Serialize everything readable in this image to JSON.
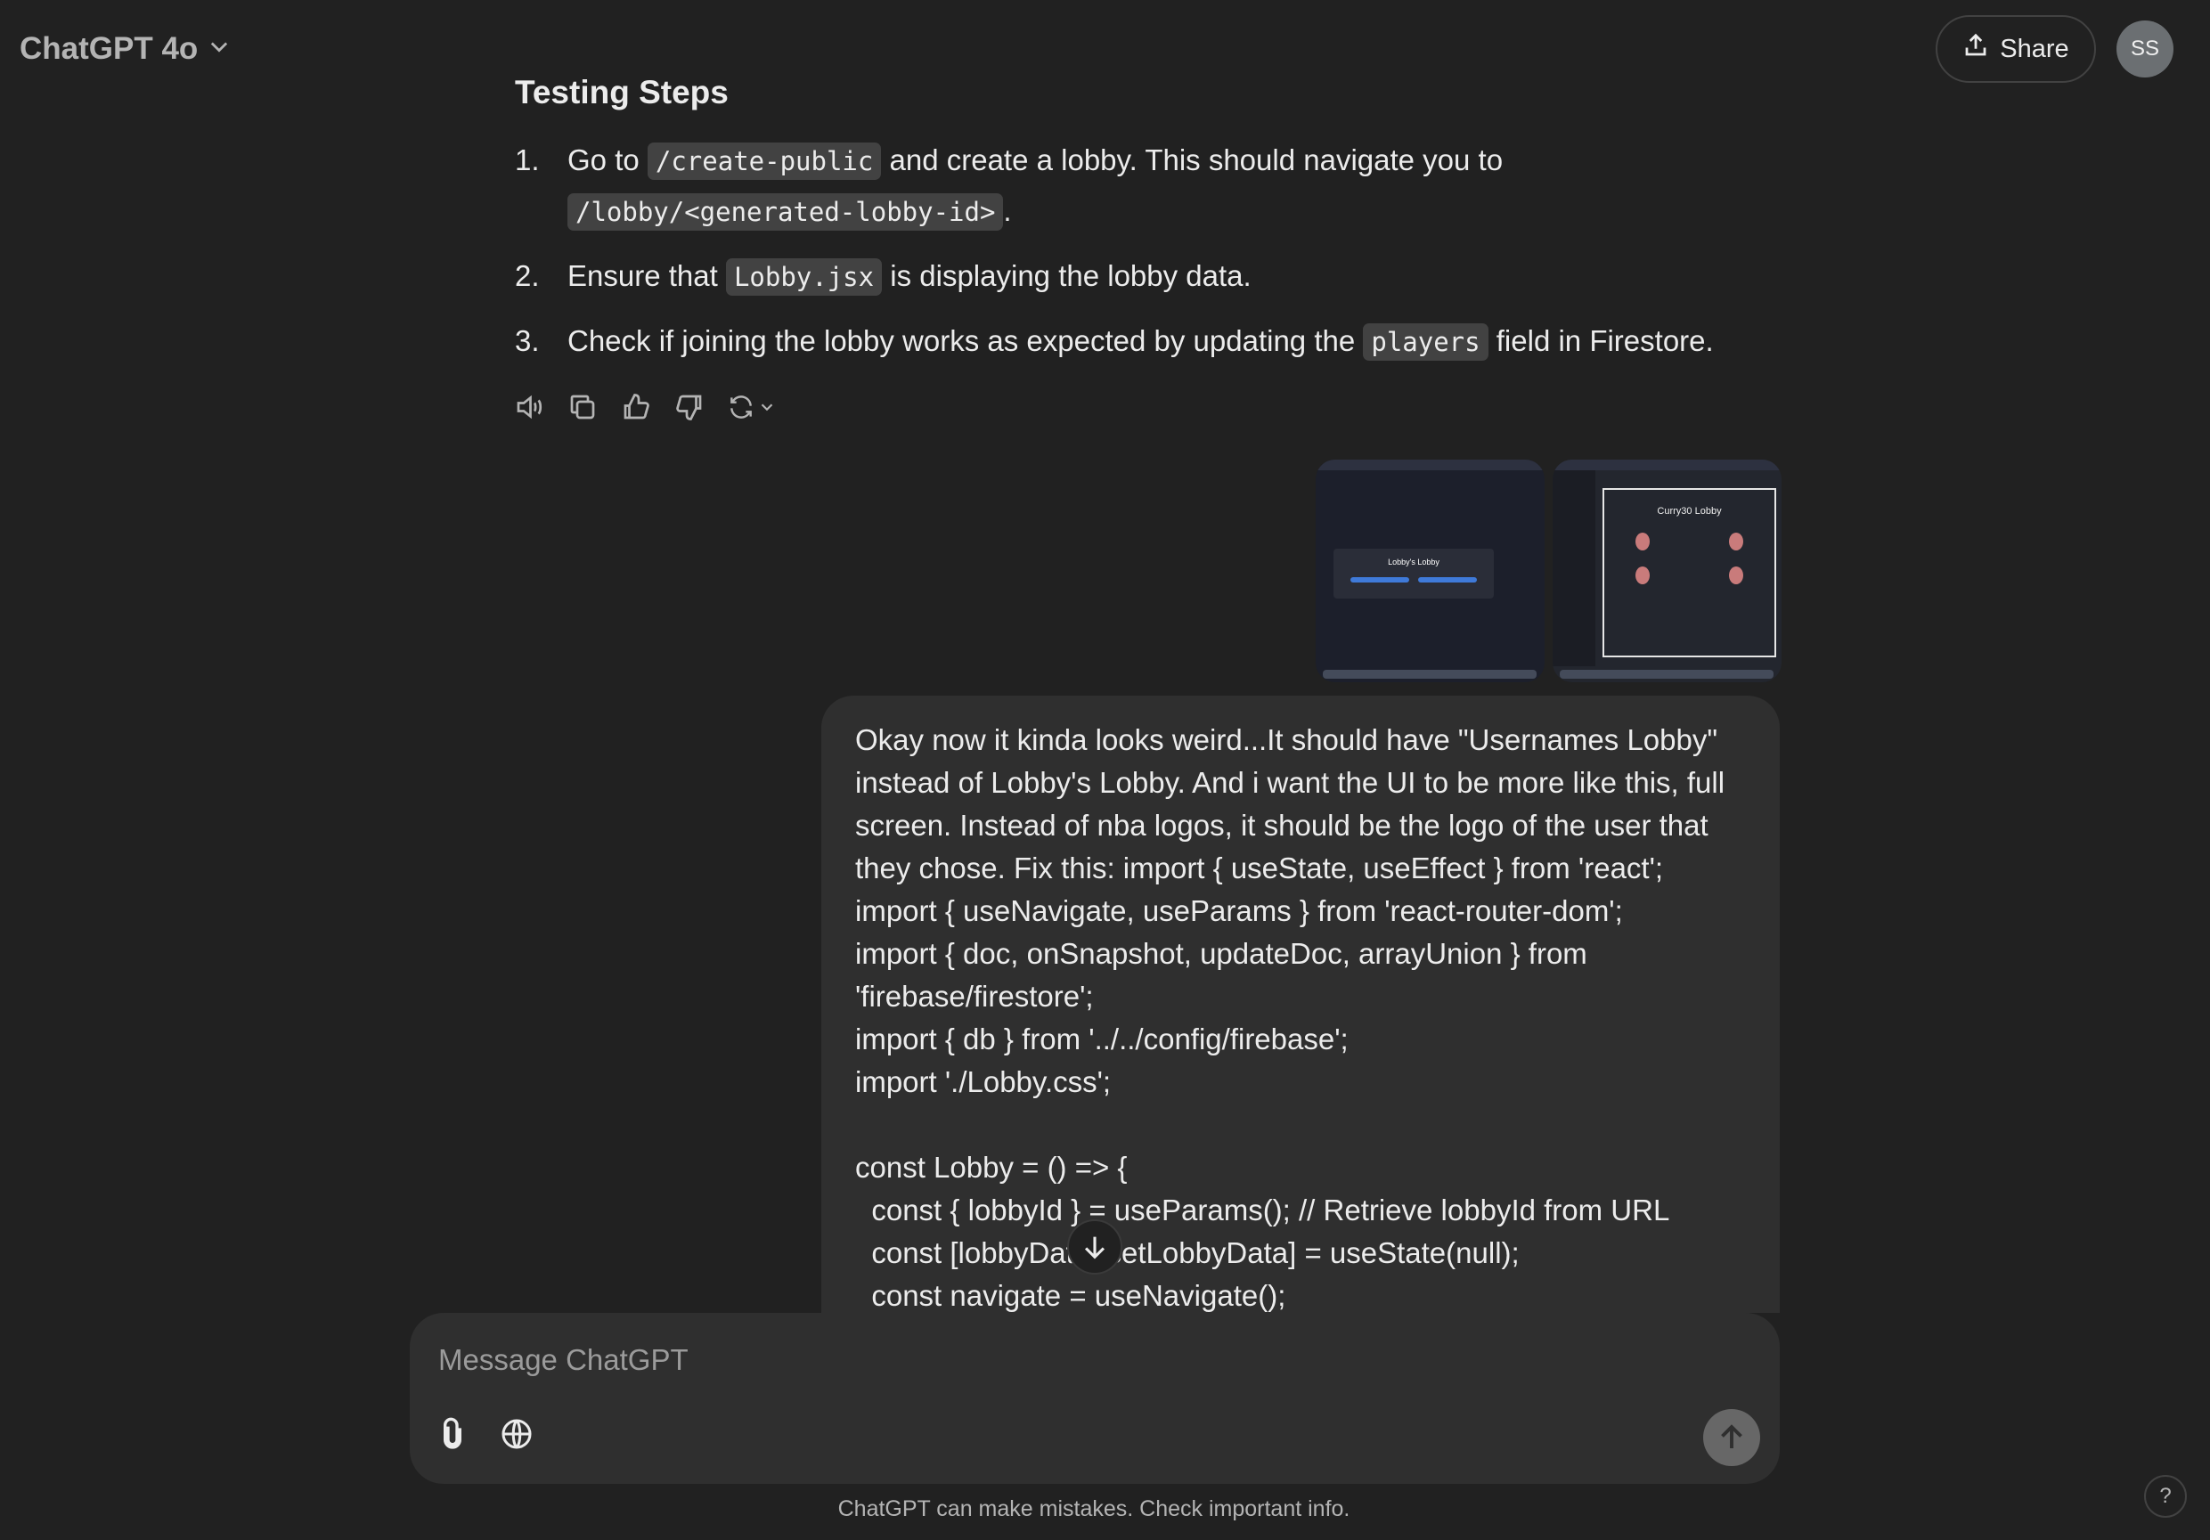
{
  "header": {
    "model_label": "ChatGPT 4o",
    "share_label": "Share",
    "avatar_initials": "SS"
  },
  "assistant_message": {
    "heading": "Testing Steps",
    "steps": [
      {
        "number": "1.",
        "text_a": "Go to ",
        "code_a": "/create-public",
        "text_b": " and create a lobby. This should navigate you to ",
        "code_b": "/lobby/<generated-lobby-id>",
        "text_c": "."
      },
      {
        "number": "2.",
        "text_a": "Ensure that ",
        "code_a": "Lobby.jsx",
        "text_b": " is displaying the lobby data."
      },
      {
        "number": "3.",
        "text_a": "Check if joining the lobby works as expected by updating the ",
        "code_a": "players",
        "text_b": " field in Firestore."
      }
    ],
    "action_icons": [
      "speaker-icon",
      "copy-icon",
      "thumbs-up-icon",
      "thumbs-down-icon",
      "regenerate-icon"
    ]
  },
  "attachments": {
    "thumb1_title": "Lobby's Lobby",
    "thumb2_title": "Curry30 Lobby"
  },
  "user_message": {
    "text": "Okay now it kinda looks weird...It should have \"Usernames Lobby\"\ninstead of Lobby's Lobby. And i want the UI to be more like this, full\nscreen. Instead of nba logos, it should be the logo of the user that\nthey chose. Fix this: import { useState, useEffect } from 'react';\nimport { useNavigate, useParams } from 'react-router-dom';\nimport { doc, onSnapshot, updateDoc, arrayUnion } from\n'firebase/firestore';\nimport { db } from '../../config/firebase';\nimport './Lobby.css';\n\nconst Lobby = () => {\n  const { lobbyId } = useParams(); // Retrieve lobbyId from URL\n  const [lobbyData, setLobbyData] = useState(null);\n  const navigate = useNavigate();"
  },
  "composer": {
    "placeholder": "Message ChatGPT"
  },
  "footer": {
    "disclaimer": "ChatGPT can make mistakes. Check important info.",
    "help_label": "?"
  }
}
